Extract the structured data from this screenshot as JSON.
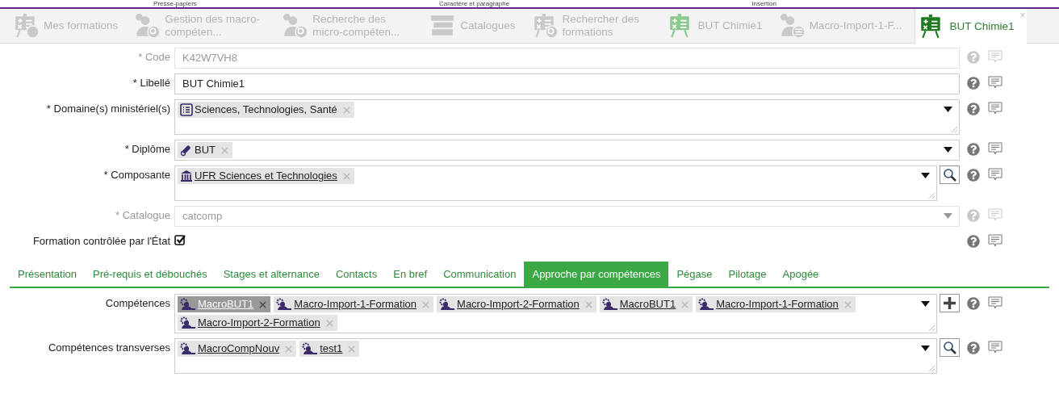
{
  "ribbon_groups": [
    "Presse-papiers",
    "Caractère et paragraphe",
    "Insertion"
  ],
  "window_tabs": [
    {
      "label": "Mes formations",
      "kind": "board-person",
      "selected": false
    },
    {
      "label": "Gestion des macro-compéten...",
      "kind": "person-search",
      "selected": false
    },
    {
      "label": "Recherche des micro-compéten...",
      "kind": "person-search",
      "selected": false
    },
    {
      "label": "Catalogues",
      "kind": "books",
      "selected": false
    },
    {
      "label": "Rechercher des formations",
      "kind": "board-search",
      "selected": false
    },
    {
      "label": "BUT Chimie1",
      "kind": "board",
      "selected": false
    },
    {
      "label": "Macro-Import-1-F...",
      "kind": "person-list",
      "selected": false
    },
    {
      "label": "BUT Chimie1",
      "kind": "board",
      "selected": true,
      "close": "×"
    }
  ],
  "fields": [
    {
      "kind": "text",
      "label": "* Code",
      "value": "K42W7VH8",
      "disabled": true
    },
    {
      "kind": "text",
      "label": "* Libellé",
      "value": "BUT Chimie1",
      "disabled": false
    },
    {
      "kind": "select",
      "label": "* Domaine(s) ministériel(s)",
      "multiline": true,
      "disabled": false,
      "tags": [
        {
          "label": "Sciences, Technologies, Santé",
          "kind": "list",
          "link": false,
          "selected": false
        }
      ]
    },
    {
      "kind": "select",
      "label": "* Diplôme",
      "multiline": false,
      "disabled": false,
      "tags": [
        {
          "label": "BUT",
          "kind": "diploma",
          "link": false,
          "selected": false
        }
      ]
    },
    {
      "kind": "select",
      "label": "* Composante",
      "multiline": true,
      "disabled": false,
      "button": {
        "kind": "search"
      },
      "tags": [
        {
          "label": "UFR Sciences et Technologies",
          "kind": "building",
          "link": true,
          "selected": false
        }
      ]
    },
    {
      "kind": "select",
      "label": "* Catalogue",
      "multiline": false,
      "disabled": true,
      "value": "catcomp"
    },
    {
      "kind": "checkbox",
      "label": "Formation contrôlée par l'État",
      "checked": true,
      "disabled": false
    }
  ],
  "section_tabs": [
    {
      "label": "Présentation",
      "selected": false
    },
    {
      "label": "Pré-requis et débouchés",
      "selected": false
    },
    {
      "label": "Stages et alternance",
      "selected": false
    },
    {
      "label": "Contacts",
      "selected": false
    },
    {
      "label": "En bref",
      "selected": false
    },
    {
      "label": "Communication",
      "selected": false
    },
    {
      "label": "Approche par compétences",
      "selected": true
    },
    {
      "label": "Pégase",
      "selected": false
    },
    {
      "label": "Pilotage",
      "selected": false
    },
    {
      "label": "Apogée",
      "selected": false
    }
  ],
  "section_fields": [
    {
      "kind": "select",
      "label": "Compétences",
      "multiline": true,
      "disabled": false,
      "button": {
        "kind": "plus"
      },
      "tags": [
        {
          "label": "MacroBUT1",
          "kind": "macro",
          "link": true,
          "selected": true
        },
        {
          "label": "Macro-Import-1-Formation",
          "kind": "macro",
          "link": true,
          "selected": false
        },
        {
          "label": "Macro-Import-2-Formation",
          "kind": "macro",
          "link": true,
          "selected": false
        },
        {
          "label": "MacroBUT1",
          "kind": "macro",
          "link": true,
          "selected": false
        },
        {
          "label": "Macro-Import-1-Formation",
          "kind": "macro",
          "link": true,
          "selected": false
        },
        {
          "label": "Macro-Import-2-Formation",
          "kind": "macro",
          "link": true,
          "selected": false
        }
      ]
    },
    {
      "kind": "select",
      "label": "Compétences transverses",
      "multiline": true,
      "disabled": false,
      "button": {
        "kind": "search"
      },
      "tags": [
        {
          "label": "MacroCompNouv",
          "kind": "macro",
          "link": true,
          "selected": false
        },
        {
          "label": "test1",
          "kind": "macro",
          "link": true,
          "selected": false
        }
      ]
    }
  ]
}
